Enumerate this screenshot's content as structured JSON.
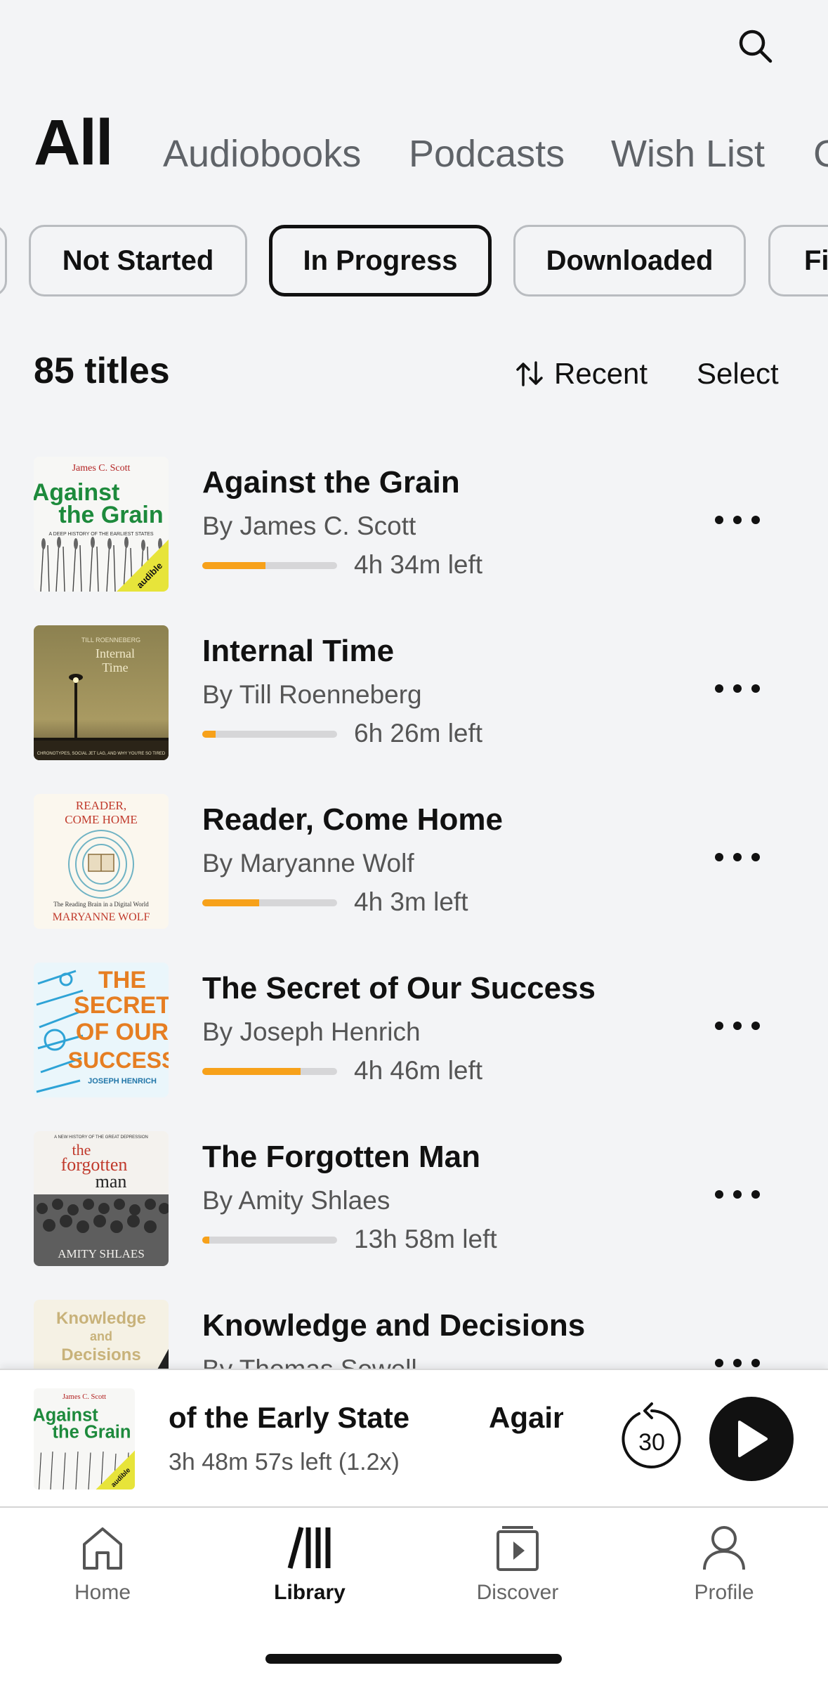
{
  "header": {
    "search_icon": "search-icon"
  },
  "tabs": [
    {
      "label": "All",
      "active": true
    },
    {
      "label": "Audiobooks"
    },
    {
      "label": "Podcasts"
    },
    {
      "label": "Wish List"
    },
    {
      "label": "C"
    }
  ],
  "filters": [
    {
      "label": ""
    },
    {
      "label": "Not Started"
    },
    {
      "label": "In Progress",
      "active": true
    },
    {
      "label": "Downloaded"
    },
    {
      "label": "Fi"
    }
  ],
  "summary": {
    "count": "85 titles",
    "sort_label": "Recent",
    "select_label": "Select"
  },
  "books": [
    {
      "title": "Against the Grain",
      "author": "By James C. Scott",
      "time_left": "4h 34m left",
      "progress": 0.47,
      "cover": {
        "line1": "James C. Scott",
        "line2": "Against",
        "line3": "the Grain",
        "sub": "A DEEP HISTORY OF THE EARLIEST STATES",
        "badge": "audible"
      }
    },
    {
      "title": "Internal Time",
      "author": "By Till Roenneberg",
      "time_left": "6h 26m left",
      "progress": 0.1,
      "cover": {
        "line1": "TILL ROENNEBERG",
        "line2": "Internal",
        "line3": "Time",
        "sub": "CHRONOTYPES, SOCIAL JET LAG, AND WHY YOU'RE SO TIRED"
      }
    },
    {
      "title": "Reader, Come Home",
      "author": "By Maryanne Wolf",
      "time_left": "4h 3m left",
      "progress": 0.42,
      "cover": {
        "line1": "READER,",
        "line2": "COME HOME",
        "line3": "MARYANNE WOLF",
        "sub": "The Reading Brain in a Digital World"
      }
    },
    {
      "title": "The Secret of Our Success",
      "author": "By Joseph Henrich",
      "time_left": "4h 46m left",
      "progress": 0.73,
      "cover": {
        "line1": "THE",
        "line2": "SECRET",
        "line3": "OF OUR",
        "line4": "SUCCESS",
        "sub": "JOSEPH HENRICH"
      }
    },
    {
      "title": "The Forgotten Man",
      "author": "By Amity Shlaes",
      "time_left": "13h 58m left",
      "progress": 0.05,
      "cover": {
        "line1": "A NEW HISTORY OF THE GREAT DEPRESSION",
        "line2": "the",
        "line3": "forgotten",
        "line4": "man",
        "sub": "AMITY SHLAES"
      }
    },
    {
      "title": "Knowledge and Decisions",
      "author": "By Thomas Sowell",
      "time_left": "",
      "progress": 0,
      "cover": {
        "line1": "Knowledge",
        "line2": "and",
        "line3": "Decisions"
      }
    }
  ],
  "player": {
    "title_tail": "of the Early State",
    "title_next": "Again",
    "time_left": "3h 48m 57s left (1.2x)",
    "skip_seconds": "30",
    "cover": {
      "line1": "James C. Scott",
      "line2": "Against",
      "line3": "the Grain",
      "badge": "audible"
    }
  },
  "nav": [
    {
      "label": "Home",
      "icon": "home-icon"
    },
    {
      "label": "Library",
      "icon": "library-icon",
      "active": true
    },
    {
      "label": "Discover",
      "icon": "discover-icon"
    },
    {
      "label": "Profile",
      "icon": "profile-icon"
    }
  ],
  "colors": {
    "accent_progress": "#f7a11a",
    "background": "#f3f4f6",
    "track": "#d6d6d8"
  }
}
